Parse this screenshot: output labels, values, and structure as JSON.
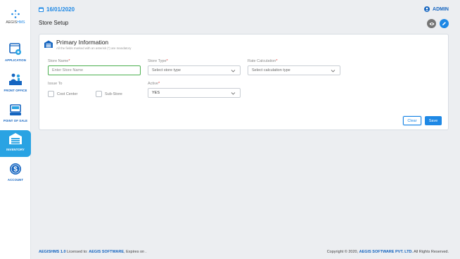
{
  "brand": {
    "name_part1": "AEGIS",
    "name_part2": "HMS"
  },
  "sidebar": {
    "items": [
      {
        "label": "APPLICATION",
        "icon": "application-settings-icon",
        "active": false
      },
      {
        "label": "FRONT OFFICE",
        "icon": "front-office-icon",
        "active": false
      },
      {
        "label": "POINT OF SALE",
        "icon": "point-of-sale-icon",
        "active": false
      },
      {
        "label": "INVENTORY",
        "icon": "inventory-icon",
        "active": true
      },
      {
        "label": "ACCOUNT",
        "icon": "account-dollar-icon",
        "active": false
      }
    ]
  },
  "header": {
    "date": "16/01/2020",
    "user": "ADMIN",
    "page_title": "Store Setup"
  },
  "form": {
    "title": "Primary Information",
    "subtitle": "All the fields marked with an asterisk (*) are mandatory",
    "store_name": {
      "label": "Store Name",
      "required_mark": "*",
      "placeholder": "Enter Store Name",
      "value": ""
    },
    "store_type": {
      "label": "Store Type",
      "required_mark": "*",
      "selected": "Select store type"
    },
    "rate_calculation": {
      "label": "Rate Calculation",
      "required_mark": "*",
      "selected": "Select calculation type"
    },
    "issue_to": {
      "label": "Issue To",
      "options": [
        {
          "label": "Cost Center",
          "checked": false
        },
        {
          "label": "Sub-Store",
          "checked": false
        }
      ]
    },
    "active": {
      "label": "Active",
      "required_mark": "*",
      "selected": "YES"
    },
    "buttons": {
      "clear": "Clear",
      "save": "Save"
    }
  },
  "footer": {
    "product": "AEGISHMS 1.0",
    "licensed_text": " Licensed to: ",
    "licensee": "AEGIS SOFTWARE",
    "expires_text": ", Expires on .",
    "copyright": "Copyright © 2020, ",
    "company": "AEGIS SOFTWARE PVT. LTD.",
    "rights": " All Rights Reserved."
  },
  "colors": {
    "accent": "#1e88e5",
    "sidebar_active": "#29a3e3",
    "focus_border": "#4caf50",
    "required": "#e53935"
  }
}
